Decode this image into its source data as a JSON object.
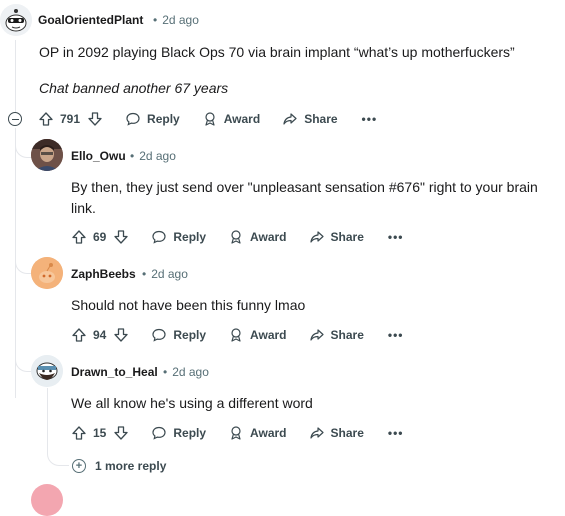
{
  "comments": [
    {
      "username": "GoalOrientedPlant",
      "time": "2d ago",
      "lines": [
        "OP in 2092 playing Black Ops 70 via brain implant “what’s up motherfuckers”",
        "Chat banned another 67 years"
      ],
      "votes": "791"
    },
    {
      "username": "Ello_Owu",
      "time": "2d ago",
      "lines": [
        "By then, they just send over \"unpleasant sensation #676\" right to your brain link."
      ],
      "votes": "69"
    },
    {
      "username": "ZaphBeebs",
      "time": "2d ago",
      "lines": [
        "Should not have been this funny lmao"
      ],
      "votes": "94"
    },
    {
      "username": "Drawn_to_Heal",
      "time": "2d ago",
      "lines": [
        "We all know he's using a different word"
      ],
      "votes": "15"
    }
  ],
  "actions": {
    "reply": "Reply",
    "award": "Award",
    "share": "Share",
    "more": "•••"
  },
  "meta_separator": "•",
  "more_replies": "1 more reply",
  "colors": {
    "text": "#1a1a1b",
    "meta": "#576f76",
    "thread_line": "#e5e7eb"
  },
  "icons": [
    "upvote-icon",
    "downvote-icon",
    "reply-icon",
    "award-icon",
    "share-icon",
    "collapse-icon",
    "expand-icon"
  ]
}
